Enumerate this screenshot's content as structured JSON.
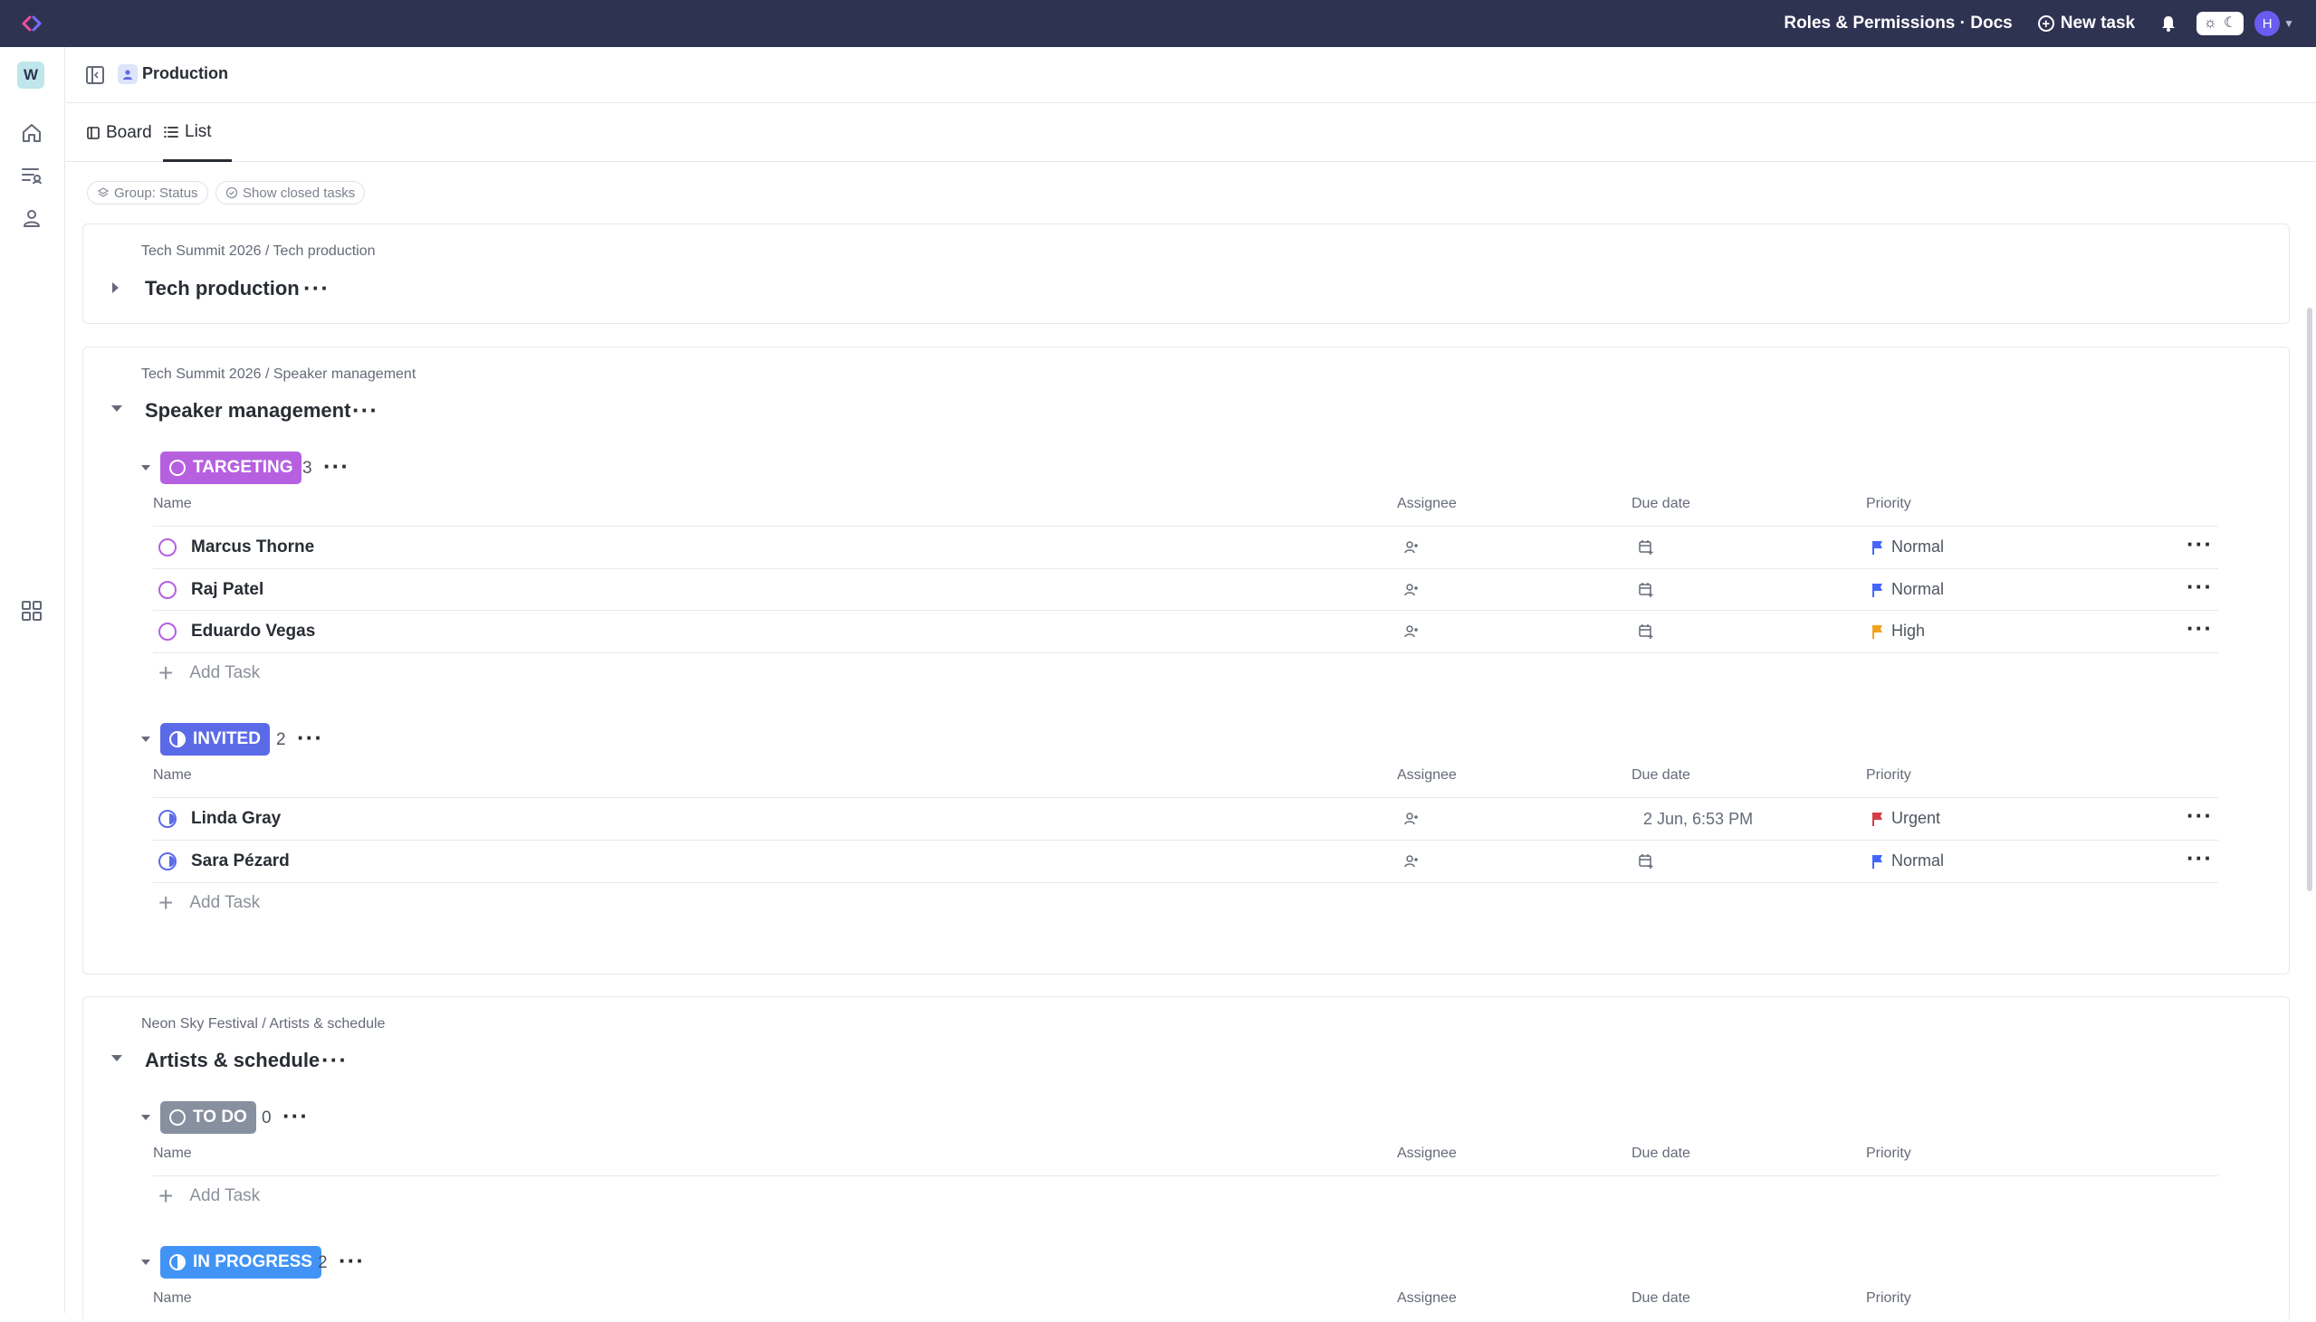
{
  "topbar": {
    "title": "Roles & Permissions · Docs",
    "new_task_label": "New task",
    "avatar_initial": "H"
  },
  "workspace": {
    "initial": "W"
  },
  "header": {
    "space_name": "Production"
  },
  "view_tabs": [
    {
      "label": "Board",
      "active": false
    },
    {
      "label": "List",
      "active": true
    }
  ],
  "filters": {
    "group_label": "Group: Status",
    "closed_label": "Show closed tasks"
  },
  "columns": {
    "name": "Name",
    "assignee": "Assignee",
    "due": "Due date",
    "priority": "Priority"
  },
  "add_task_label": "Add Task",
  "sections": [
    {
      "breadcrumb": "Tech Summit 2026 / Tech production",
      "title": "Tech production",
      "expanded": false
    },
    {
      "breadcrumb": "Tech Summit 2026 / Speaker management",
      "title": "Speaker management",
      "expanded": true,
      "groups": [
        {
          "status": "TARGETING",
          "color": "#b660e0",
          "count": "3",
          "tasks": [
            {
              "name": "Marcus Thorne",
              "due": "",
              "priority": "Normal",
              "priority_color": "#4466ff"
            },
            {
              "name": "Raj Patel",
              "due": "",
              "priority": "Normal",
              "priority_color": "#4466ff"
            },
            {
              "name": "Eduardo Vegas",
              "due": "",
              "priority": "High",
              "priority_color": "#f0a220"
            }
          ]
        },
        {
          "status": "INVITED",
          "color": "#5b6be8",
          "count": "2",
          "tasks": [
            {
              "name": "Linda Gray",
              "due": "2 Jun, 6:53 PM",
              "priority": "Urgent",
              "priority_color": "#d33d44"
            },
            {
              "name": "Sara Pézard",
              "due": "",
              "priority": "Normal",
              "priority_color": "#4466ff"
            }
          ]
        }
      ]
    },
    {
      "breadcrumb": "Neon Sky Festival / Artists & schedule",
      "title": "Artists & schedule",
      "expanded": true,
      "groups": [
        {
          "status": "TO DO",
          "color": "#87909e",
          "count": "0",
          "tasks": []
        },
        {
          "status": "IN PROGRESS",
          "color": "#4194f6",
          "count": "2",
          "tasks": []
        }
      ]
    }
  ]
}
